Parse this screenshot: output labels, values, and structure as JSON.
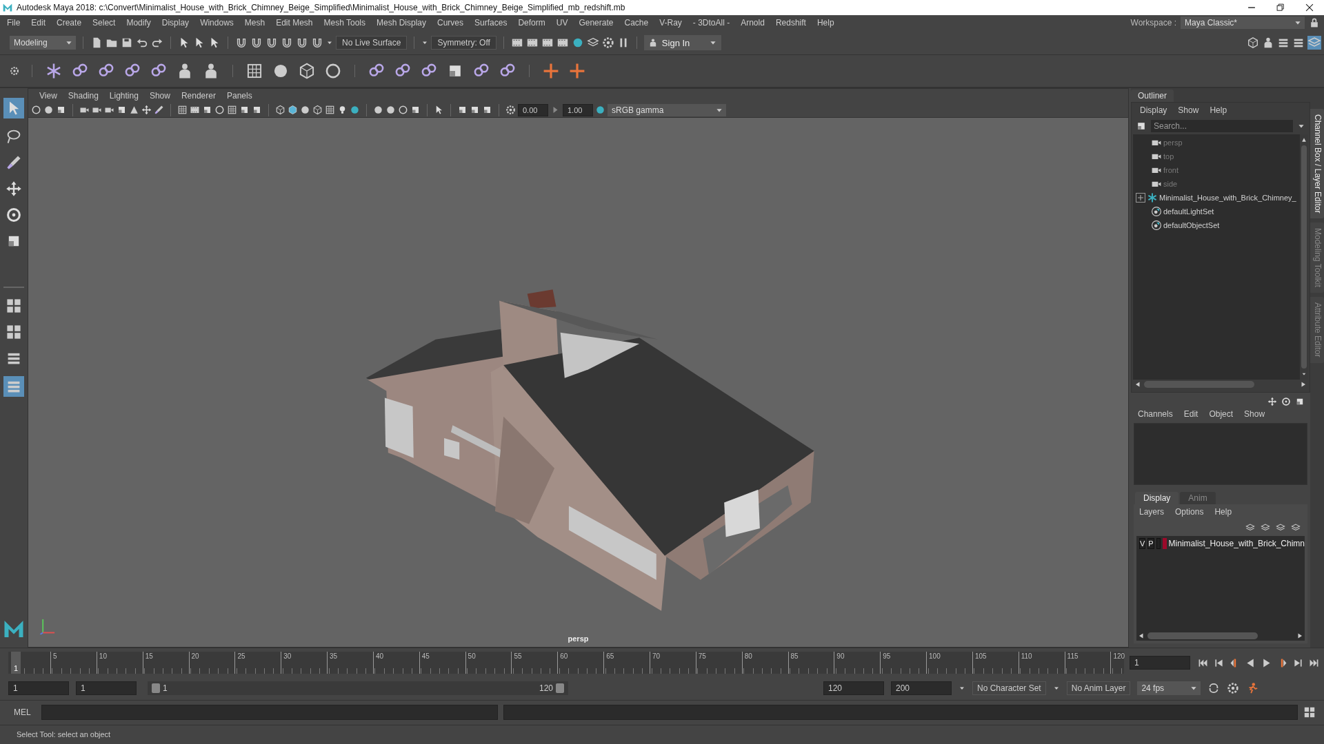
{
  "window": {
    "title": "Autodesk Maya 2018: c:\\Convert\\Minimalist_House_with_Brick_Chimney_Beige_Simplified\\Minimalist_House_with_Brick_Chimney_Beige_Simplified_mb_redshift.mb"
  },
  "menu_bar": [
    "File",
    "Edit",
    "Create",
    "Select",
    "Modify",
    "Display",
    "Windows",
    "Mesh",
    "Edit Mesh",
    "Mesh Tools",
    "Mesh Display",
    "Curves",
    "Surfaces",
    "Deform",
    "UV",
    "Generate",
    "Cache",
    "V-Ray",
    "- 3DtoAll -",
    "Arnold",
    "Redshift",
    "Help"
  ],
  "workspace": {
    "label": "Workspace :",
    "value": "Maya Classic*"
  },
  "status_line": {
    "mode": "Modeling",
    "live_surface": "No Live Surface",
    "symmetry": "Symmetry: Off",
    "sign_in": "Sign In"
  },
  "viewport": {
    "menus": [
      "View",
      "Shading",
      "Lighting",
      "Show",
      "Renderer",
      "Panels"
    ],
    "exposure": "0.00",
    "gamma": "1.00",
    "color_space": "sRGB gamma",
    "camera_label": "persp"
  },
  "outliner": {
    "title": "Outliner",
    "menus": [
      "Display",
      "Show",
      "Help"
    ],
    "search_placeholder": "Search...",
    "items": [
      {
        "label": "persp",
        "kind": "camera",
        "dimmed": true
      },
      {
        "label": "top",
        "kind": "camera",
        "dimmed": true
      },
      {
        "label": "front",
        "kind": "camera",
        "dimmed": true
      },
      {
        "label": "side",
        "kind": "camera",
        "dimmed": true
      },
      {
        "label": "Minimalist_House_with_Brick_Chimney_",
        "kind": "group",
        "dimmed": false,
        "expanded": false
      },
      {
        "label": "defaultLightSet",
        "kind": "set",
        "dimmed": false
      },
      {
        "label": "defaultObjectSet",
        "kind": "set",
        "dimmed": false
      }
    ]
  },
  "channel_box": {
    "menus": [
      "Channels",
      "Edit",
      "Object",
      "Show"
    ]
  },
  "layer_editor": {
    "tabs": [
      {
        "label": "Display",
        "selected": true
      },
      {
        "label": "Anim",
        "selected": false
      }
    ],
    "menus": [
      "Layers",
      "Options",
      "Help"
    ],
    "layers": [
      {
        "visibility": "V",
        "playback": "P",
        "color": "#9b0a2a",
        "name": "Minimalist_House_with_Brick_Chimn"
      }
    ]
  },
  "side_tabs": [
    {
      "label": "Channel Box / Layer Editor",
      "selected": true
    },
    {
      "label": "Modeling Toolkit",
      "selected": false
    },
    {
      "label": "Attribute Editor",
      "selected": false
    }
  ],
  "timeline": {
    "current_frame": "1",
    "level": 0,
    "ticks": [
      "5",
      "10",
      "15",
      "20",
      "25",
      "30",
      "35",
      "40",
      "45",
      "50",
      "55",
      "60",
      "65",
      "70",
      "75",
      "80",
      "85",
      "90",
      "95",
      "100",
      "105",
      "110",
      "115",
      "120"
    ],
    "frame_field": "1"
  },
  "range": {
    "start": "1",
    "playback_start": "1",
    "slider_start": "1",
    "slider_end": "120",
    "playback_end": "120",
    "end": "200",
    "character_set": "No Character Set",
    "anim_layer": "No Anim Layer",
    "fps": "24 fps"
  },
  "command_line": {
    "language": "MEL"
  },
  "help_line": "Select Tool: select an object"
}
